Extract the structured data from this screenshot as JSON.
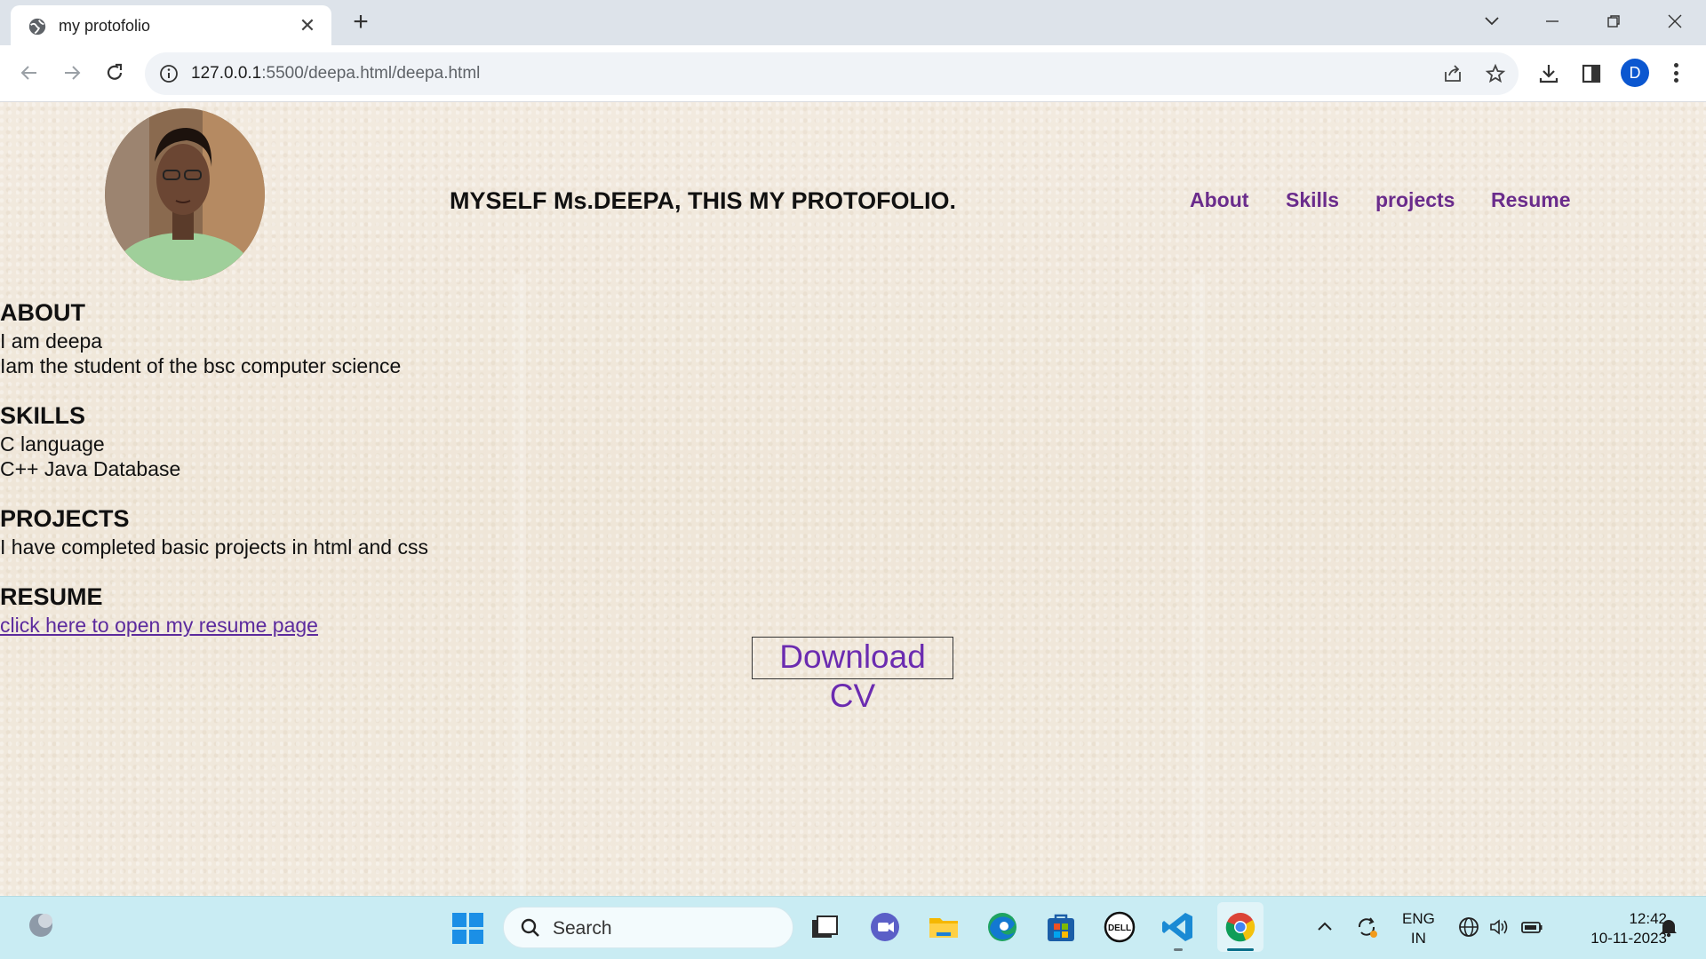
{
  "browser": {
    "tab_title": "my protofolio",
    "url_host": "127.0.0.1",
    "url_rest": ":5500/deepa.html/deepa.html",
    "profile_initial": "D"
  },
  "site": {
    "title": "MYSELF Ms.DEEPA, THIS MY PROTOFOLIO.",
    "nav": [
      "About",
      "Skills",
      "projects",
      "Resume"
    ],
    "about": {
      "heading": "ABOUT",
      "line1": "I am deepa",
      "line2": "Iam the student of the bsc computer science"
    },
    "skills": {
      "heading": "SKILLS",
      "line1": "C language",
      "line2": "C++ Java Database"
    },
    "projects": {
      "heading": "PROJECTS",
      "line1": "I have completed basic projects in html and css"
    },
    "resume": {
      "heading": "RESUME",
      "link": "click here to open my resume page"
    },
    "download_button": "Download CV"
  },
  "taskbar": {
    "search_placeholder": "Search",
    "lang_top": "ENG",
    "lang_bottom": "IN",
    "time": "12:42",
    "date": "10-11-2023"
  },
  "colors": {
    "nav_purple": "#6a2c8c",
    "link_purple": "#5c2a9d",
    "taskbar": "#c9ecf3",
    "page_bg": "#f1e9dc"
  }
}
